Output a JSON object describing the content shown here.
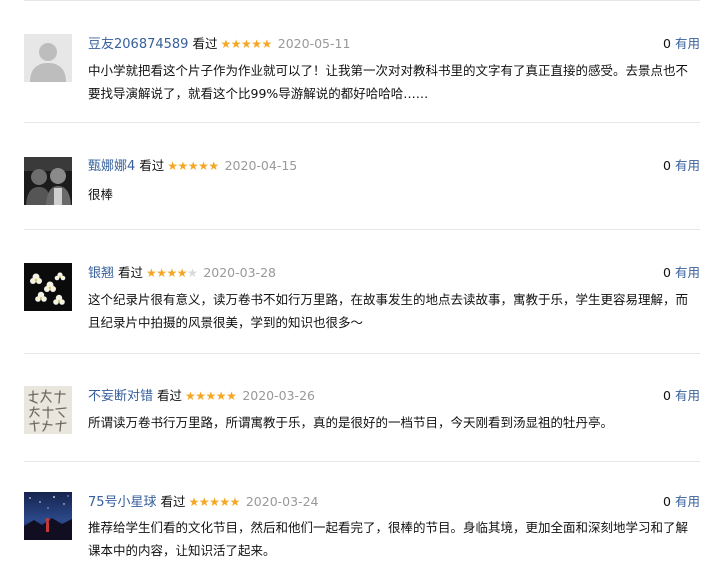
{
  "watched_label": "看过",
  "useful_label": "有用",
  "reviews": [
    {
      "user": "豆友206874589",
      "rating": 5,
      "date": "2020-05-11",
      "useful_count": "0",
      "text": "中小学就把看这个片子作为作业就可以了！让我第一次对对教科书里的文字有了真正直接的感受。去景点也不要找导演解说了，就看这个比99%导游解说的都好哈哈哈……",
      "avatar": "default-avatar"
    },
    {
      "user": "甄娜娜4",
      "rating": 5,
      "date": "2020-04-15",
      "useful_count": "0",
      "text": "很棒",
      "avatar": "photo-avatar"
    },
    {
      "user": "银翘",
      "rating": 4,
      "date": "2020-03-28",
      "useful_count": "0",
      "text": "这个纪录片很有意义，读万卷书不如行万里路，在故事发生的地点去读故事，寓教于乐，学生更容易理解，而且纪录片中拍摄的风景很美，学到的知识也很多～",
      "avatar": "flower-avatar"
    },
    {
      "user": "不妄断对错",
      "rating": 5,
      "date": "2020-03-26",
      "useful_count": "0",
      "text": "所谓读万卷书行万里路，所谓寓教于乐，真的是很好的一档节目，今天刚看到汤显祖的牡丹亭。",
      "avatar": "calligraphy-avatar"
    },
    {
      "user": "75号小星球",
      "rating": 5,
      "date": "2020-03-24",
      "useful_count": "0",
      "text": "推荐给学生们看的文化节目，然后和他们一起看完了，很棒的节目。身临其境，更加全面和深刻地学习和了解课本中的内容，让知识活了起来。",
      "avatar": "night-sky-avatar"
    }
  ],
  "colors": {
    "link": "#37609c",
    "star_on": "#f5a623",
    "star_off": "#d9d9d9",
    "date": "#999999",
    "divider": "#e6e6e6"
  }
}
